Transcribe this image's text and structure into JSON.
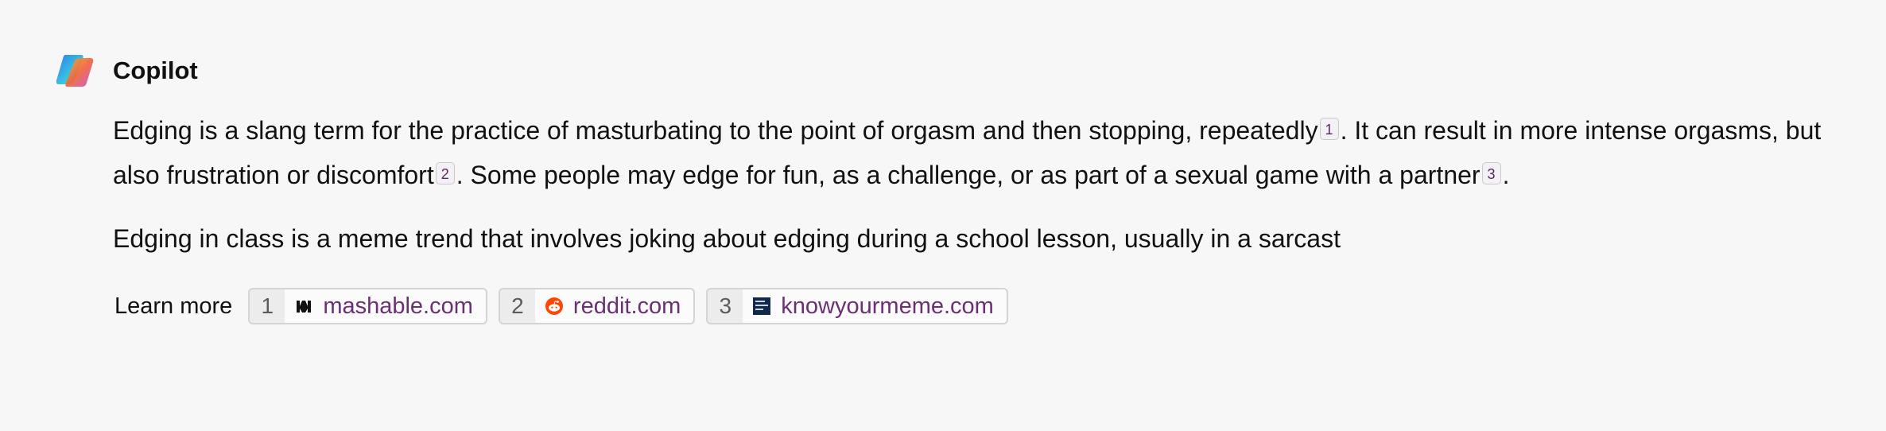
{
  "header": {
    "app_name": "Copilot"
  },
  "message": {
    "p1_part1": "Edging is a slang term for the practice of masturbating to the point of orgasm and then stopping, repeatedly",
    "p1_cite1": "1",
    "p1_part2": ". It can result in more intense orgasms, but also frustration or discomfort",
    "p1_cite2": "2",
    "p1_part3": ". Some people may edge for fun, as a challenge, or as part of a sexual game with a partner",
    "p1_cite3": "3",
    "p1_part4": ".",
    "p2": "Edging in class is a meme trend that involves joking about edging during a school lesson, usually in a sarcast"
  },
  "learn_more": {
    "label": "Learn more",
    "sources": [
      {
        "num": "1",
        "domain": "mashable.com",
        "icon": "mashable-icon"
      },
      {
        "num": "2",
        "domain": "reddit.com",
        "icon": "reddit-icon"
      },
      {
        "num": "3",
        "domain": "knowyourmeme.com",
        "icon": "knowyourmeme-icon"
      }
    ]
  },
  "colors": {
    "background": "#f7f7f7",
    "text": "#111111",
    "link": "#6b2f74",
    "reddit": "#ff4500",
    "knowyourmeme": "#12284b"
  }
}
